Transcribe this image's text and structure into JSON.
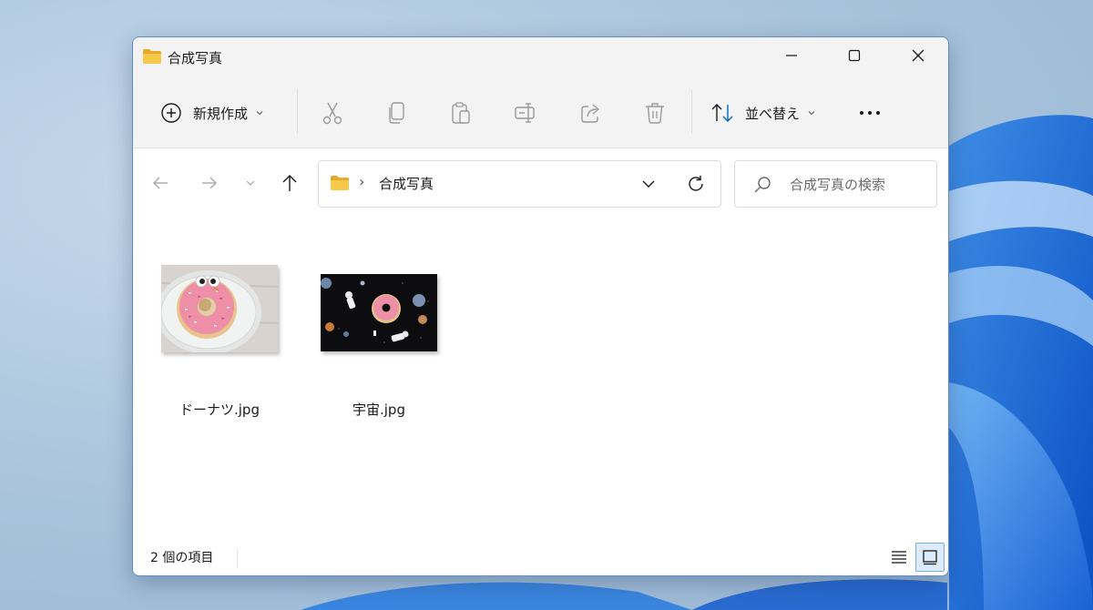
{
  "window": {
    "title": "合成写真"
  },
  "toolbar": {
    "new_label": "新規作成",
    "sort_label": "並べ替え",
    "icons": [
      "plus-circle-icon",
      "cut-icon",
      "copy-icon",
      "paste-icon",
      "rename-icon",
      "share-icon",
      "delete-icon",
      "sort-icon",
      "more-icon"
    ]
  },
  "address": {
    "path_segment": "合成写真",
    "separator": "›"
  },
  "search": {
    "placeholder": "合成写真の検索"
  },
  "files": [
    {
      "name": "ドーナツ.jpg",
      "thumbnail": "pink-donut-with-eyes"
    },
    {
      "name": "宇宙.jpg",
      "thumbnail": "space-donut-astronauts"
    }
  ],
  "status": {
    "item_count_text": "2 個の項目"
  },
  "colors": {
    "accent": "#0067c0",
    "titlebar": "#f3f3f3",
    "folder": "#f4c543"
  }
}
